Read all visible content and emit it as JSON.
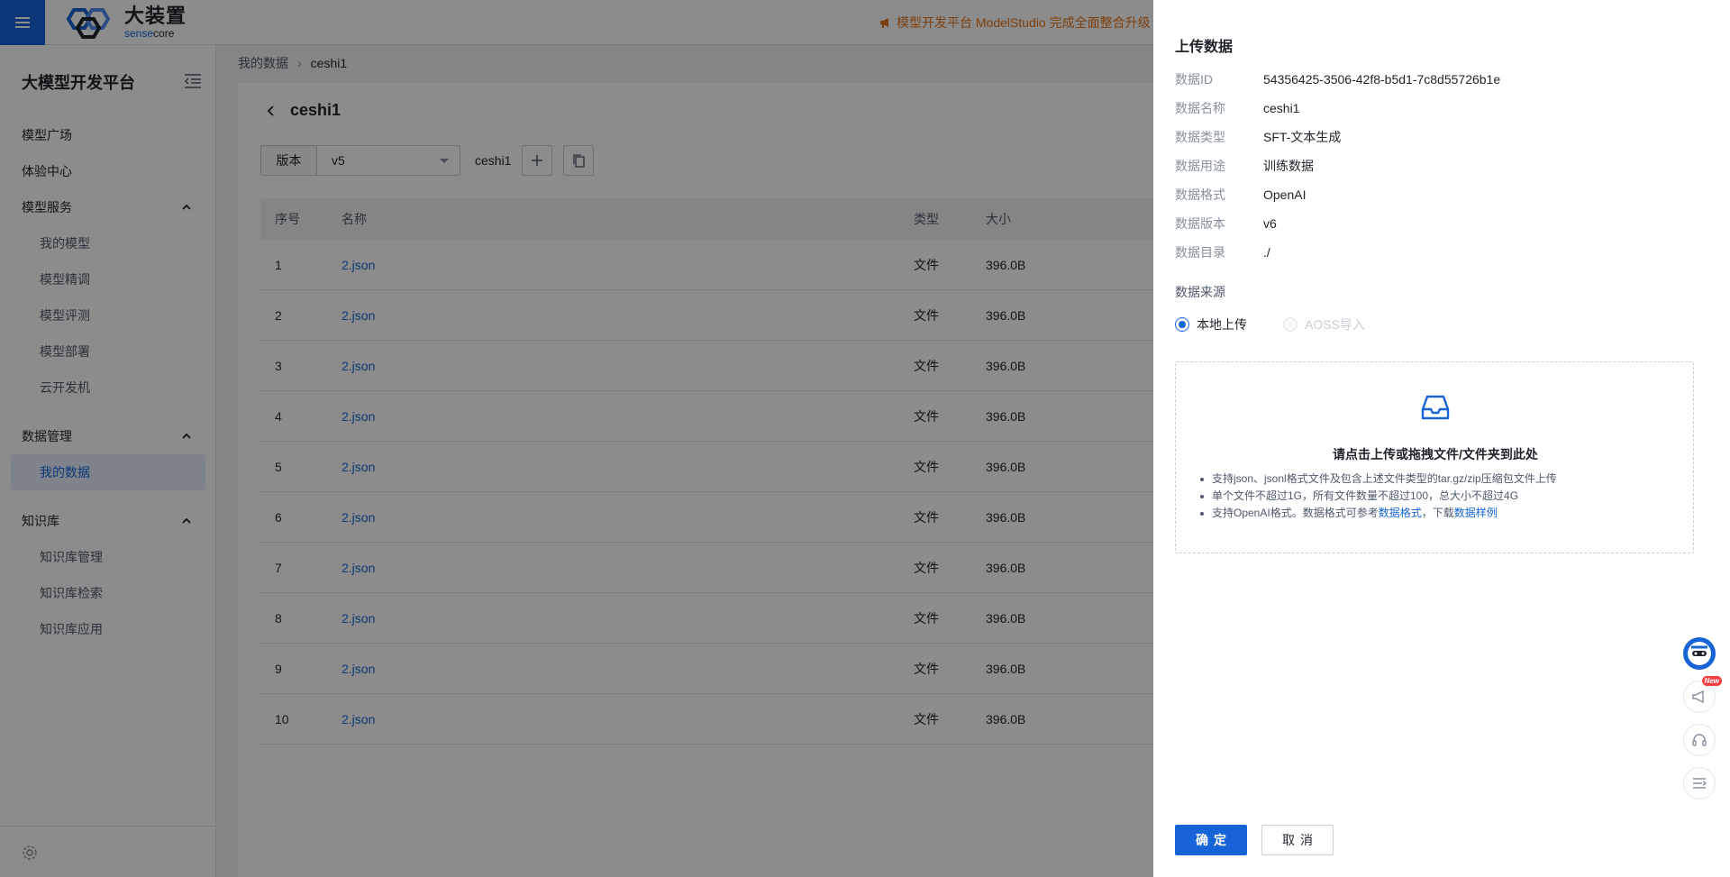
{
  "topbar": {
    "logo_cn": "大装置",
    "logo_en_a": "sense",
    "logo_en_b": "core",
    "announcement": "模型开发平台 ModelStudio 完成全面整合升级"
  },
  "sidebar": {
    "title": "大模型开发平台",
    "items": [
      {
        "label": "模型广场"
      },
      {
        "label": "体验中心"
      },
      {
        "label": "模型服务"
      },
      {
        "label": "我的模型"
      },
      {
        "label": "模型精调"
      },
      {
        "label": "模型评测"
      },
      {
        "label": "模型部署"
      },
      {
        "label": "云开发机"
      },
      {
        "label": "数据管理"
      },
      {
        "label": "我的数据"
      },
      {
        "label": "知识库"
      },
      {
        "label": "知识库管理"
      },
      {
        "label": "知识库检索"
      },
      {
        "label": "知识库应用"
      }
    ]
  },
  "breadcrumb": {
    "parent": "我的数据",
    "current": "ceshi1"
  },
  "page": {
    "title": "ceshi1",
    "version_label": "版本",
    "version_value": "v5",
    "dataset_name": "ceshi1"
  },
  "table": {
    "headers": [
      "序号",
      "名称",
      "类型",
      "大小"
    ],
    "rows": [
      {
        "no": "1",
        "name": "2.json",
        "type": "文件",
        "size": "396.0B"
      },
      {
        "no": "2",
        "name": "2.json",
        "type": "文件",
        "size": "396.0B"
      },
      {
        "no": "3",
        "name": "2.json",
        "type": "文件",
        "size": "396.0B"
      },
      {
        "no": "4",
        "name": "2.json",
        "type": "文件",
        "size": "396.0B"
      },
      {
        "no": "5",
        "name": "2.json",
        "type": "文件",
        "size": "396.0B"
      },
      {
        "no": "6",
        "name": "2.json",
        "type": "文件",
        "size": "396.0B"
      },
      {
        "no": "7",
        "name": "2.json",
        "type": "文件",
        "size": "396.0B"
      },
      {
        "no": "8",
        "name": "2.json",
        "type": "文件",
        "size": "396.0B"
      },
      {
        "no": "9",
        "name": "2.json",
        "type": "文件",
        "size": "396.0B"
      },
      {
        "no": "10",
        "name": "2.json",
        "type": "文件",
        "size": "396.0B"
      }
    ]
  },
  "drawer": {
    "title": "上传数据",
    "info": [
      {
        "key": "数据ID",
        "value": "54356425-3506-42f8-b5d1-7c8d55726b1e"
      },
      {
        "key": "数据名称",
        "value": "ceshi1"
      },
      {
        "key": "数据类型",
        "value": "SFT-文本生成"
      },
      {
        "key": "数据用途",
        "value": "训练数据"
      },
      {
        "key": "数据格式",
        "value": "OpenAI"
      },
      {
        "key": "数据版本",
        "value": "v6"
      },
      {
        "key": "数据目录",
        "value": "./"
      }
    ],
    "source_label": "数据来源",
    "source_options": [
      {
        "label": "本地上传",
        "selected": true
      },
      {
        "label": "AOSS导入",
        "selected": false
      }
    ],
    "upload": {
      "title": "请点击上传或拖拽文件/文件夹到此处",
      "tip1": "支持json、jsonl格式文件及包含上述文件类型的tar.gz/zip压缩包文件上传",
      "tip2": "单个文件不超过1G，所有文件数量不超过100，总大小不超过4G",
      "tip3_prefix": "支持OpenAI格式。数据格式可参考",
      "tip3_link1": "数据格式",
      "tip3_mid": "，下载",
      "tip3_link2": "数据样例"
    },
    "confirm": "确定",
    "cancel": "取消"
  },
  "float_tools": {
    "new_badge": "New"
  },
  "colors": {
    "primary": "#1664d7",
    "announce": "#e37318",
    "mask": "rgba(0,0,0,0.45)"
  }
}
